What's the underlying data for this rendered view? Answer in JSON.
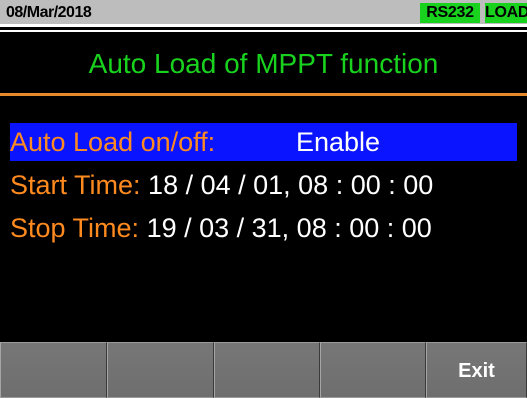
{
  "status": {
    "date": "08/Mar/2018",
    "badges": [
      "RS232",
      "LOAD"
    ]
  },
  "title": "Auto Load of MPPT function",
  "settings": {
    "auto_load": {
      "label": "Auto Load on/off:",
      "value": "Enable"
    },
    "start_time": {
      "label": "Start Time:",
      "value": "18 / 04 / 01, 08 : 00 : 00"
    },
    "stop_time": {
      "label": "Stop Time:",
      "value": "19 / 03 / 31, 08 : 00 : 00"
    }
  },
  "softkeys": [
    "",
    "",
    "",
    "",
    "Exit"
  ],
  "colors": {
    "status_bar": "#bdbdbd",
    "badge": "#19d21e",
    "title_text": "#19d21e",
    "label_text": "#ff8a1f",
    "value_text": "#ffffff",
    "selection": "#0a14ff",
    "title_underline": "#e48a2a",
    "background": "#000000"
  }
}
